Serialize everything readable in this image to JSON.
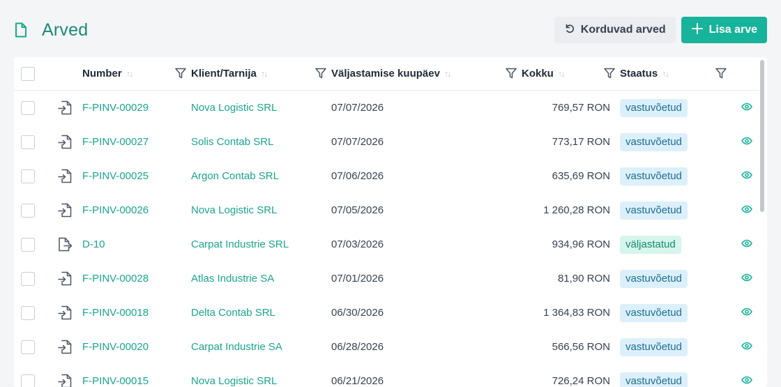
{
  "header": {
    "title": "Arved",
    "recurring_label": "Korduvad arved",
    "add_label": "Lisa arve"
  },
  "table": {
    "columns": {
      "number": "Number",
      "client": "Klient/Tarnija",
      "date": "Väljastamise kuupäev",
      "total": "Kokku",
      "status": "Staatus"
    },
    "rows": [
      {
        "number": "F-PINV-00029",
        "client": "Nova Logistic SRL",
        "date": "07/07/2026",
        "total": "769,57 RON",
        "status": "vastuvõetud",
        "kind": "incoming"
      },
      {
        "number": "F-PINV-00027",
        "client": "Solis Contab SRL",
        "date": "07/07/2026",
        "total": "773,17 RON",
        "status": "vastuvõetud",
        "kind": "incoming"
      },
      {
        "number": "F-PINV-00025",
        "client": "Argon Contab SRL",
        "date": "07/06/2026",
        "total": "635,69 RON",
        "status": "vastuvõetud",
        "kind": "incoming"
      },
      {
        "number": "F-PINV-00026",
        "client": "Nova Logistic SRL",
        "date": "07/05/2026",
        "total": "1 260,28 RON",
        "status": "vastuvõetud",
        "kind": "incoming"
      },
      {
        "number": "D-10",
        "client": "Carpat Industrie SRL",
        "date": "07/03/2026",
        "total": "934,96 RON",
        "status": "väljastatud",
        "kind": "outgoing"
      },
      {
        "number": "F-PINV-00028",
        "client": "Atlas Industrie SA",
        "date": "07/01/2026",
        "total": "81,90 RON",
        "status": "vastuvõetud",
        "kind": "incoming"
      },
      {
        "number": "F-PINV-00018",
        "client": "Delta Contab SRL",
        "date": "06/30/2026",
        "total": "1 364,83 RON",
        "status": "vastuvõetud",
        "kind": "incoming"
      },
      {
        "number": "F-PINV-00020",
        "client": "Carpat Industrie SA",
        "date": "06/28/2026",
        "total": "566,56 RON",
        "status": "vastuvõetud",
        "kind": "incoming"
      },
      {
        "number": "F-PINV-00015",
        "client": "Nova Logistic SRL",
        "date": "06/21/2026",
        "total": "726,24 RON",
        "status": "vastuvõetud",
        "kind": "incoming"
      }
    ]
  },
  "colors": {
    "accent": "#17b39a",
    "link": "#1aa58e",
    "badge_received_bg": "#dcf0fb",
    "badge_issued_bg": "#d6f5ec"
  }
}
